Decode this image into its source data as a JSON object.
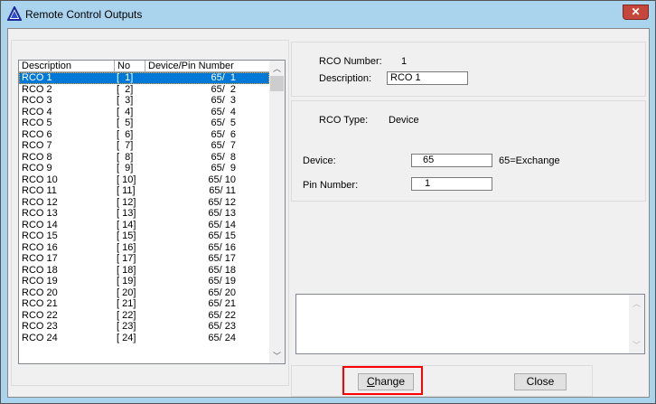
{
  "window": {
    "title": "Remote Control Outputs",
    "close_glyph": "✕"
  },
  "list": {
    "columns": [
      "Description",
      "No",
      "Device/Pin Number"
    ],
    "rows": [
      {
        "description": "RCO 1",
        "no": "[  1]",
        "device_pin": "65/  1"
      },
      {
        "description": "RCO 2",
        "no": "[  2]",
        "device_pin": "65/  2"
      },
      {
        "description": "RCO 3",
        "no": "[  3]",
        "device_pin": "65/  3"
      },
      {
        "description": "RCO 4",
        "no": "[  4]",
        "device_pin": "65/  4"
      },
      {
        "description": "RCO 5",
        "no": "[  5]",
        "device_pin": "65/  5"
      },
      {
        "description": "RCO 6",
        "no": "[  6]",
        "device_pin": "65/  6"
      },
      {
        "description": "RCO 7",
        "no": "[  7]",
        "device_pin": "65/  7"
      },
      {
        "description": "RCO 8",
        "no": "[  8]",
        "device_pin": "65/  8"
      },
      {
        "description": "RCO 9",
        "no": "[  9]",
        "device_pin": "65/  9"
      },
      {
        "description": "RCO 10",
        "no": "[ 10]",
        "device_pin": "65/ 10"
      },
      {
        "description": "RCO 11",
        "no": "[ 11]",
        "device_pin": "65/ 11"
      },
      {
        "description": "RCO 12",
        "no": "[ 12]",
        "device_pin": "65/ 12"
      },
      {
        "description": "RCO 13",
        "no": "[ 13]",
        "device_pin": "65/ 13"
      },
      {
        "description": "RCO 14",
        "no": "[ 14]",
        "device_pin": "65/ 14"
      },
      {
        "description": "RCO 15",
        "no": "[ 15]",
        "device_pin": "65/ 15"
      },
      {
        "description": "RCO 16",
        "no": "[ 16]",
        "device_pin": "65/ 16"
      },
      {
        "description": "RCO 17",
        "no": "[ 17]",
        "device_pin": "65/ 17"
      },
      {
        "description": "RCO 18",
        "no": "[ 18]",
        "device_pin": "65/ 18"
      },
      {
        "description": "RCO 19",
        "no": "[ 19]",
        "device_pin": "65/ 19"
      },
      {
        "description": "RCO 20",
        "no": "[ 20]",
        "device_pin": "65/ 20"
      },
      {
        "description": "RCO 21",
        "no": "[ 21]",
        "device_pin": "65/ 21"
      },
      {
        "description": "RCO 22",
        "no": "[ 22]",
        "device_pin": "65/ 22"
      },
      {
        "description": "RCO 23",
        "no": "[ 23]",
        "device_pin": "65/ 23"
      },
      {
        "description": "RCO 24",
        "no": "[ 24]",
        "device_pin": "65/ 24"
      }
    ],
    "selected_index": 0
  },
  "details": {
    "rco_number_label": "RCO Number:",
    "rco_number": "1",
    "description_label": "Description:",
    "description_value": "RCO 1",
    "rco_type_label": "RCO Type:",
    "rco_type": "Device",
    "device_label": "Device:",
    "device_value": "65",
    "device_note": "65=Exchange",
    "pin_label": "Pin Number:",
    "pin_value": "1"
  },
  "buttons": {
    "change": "Change",
    "close": "Close"
  },
  "colors": {
    "selection": "#0078d7",
    "highlight": "#ff0000"
  }
}
